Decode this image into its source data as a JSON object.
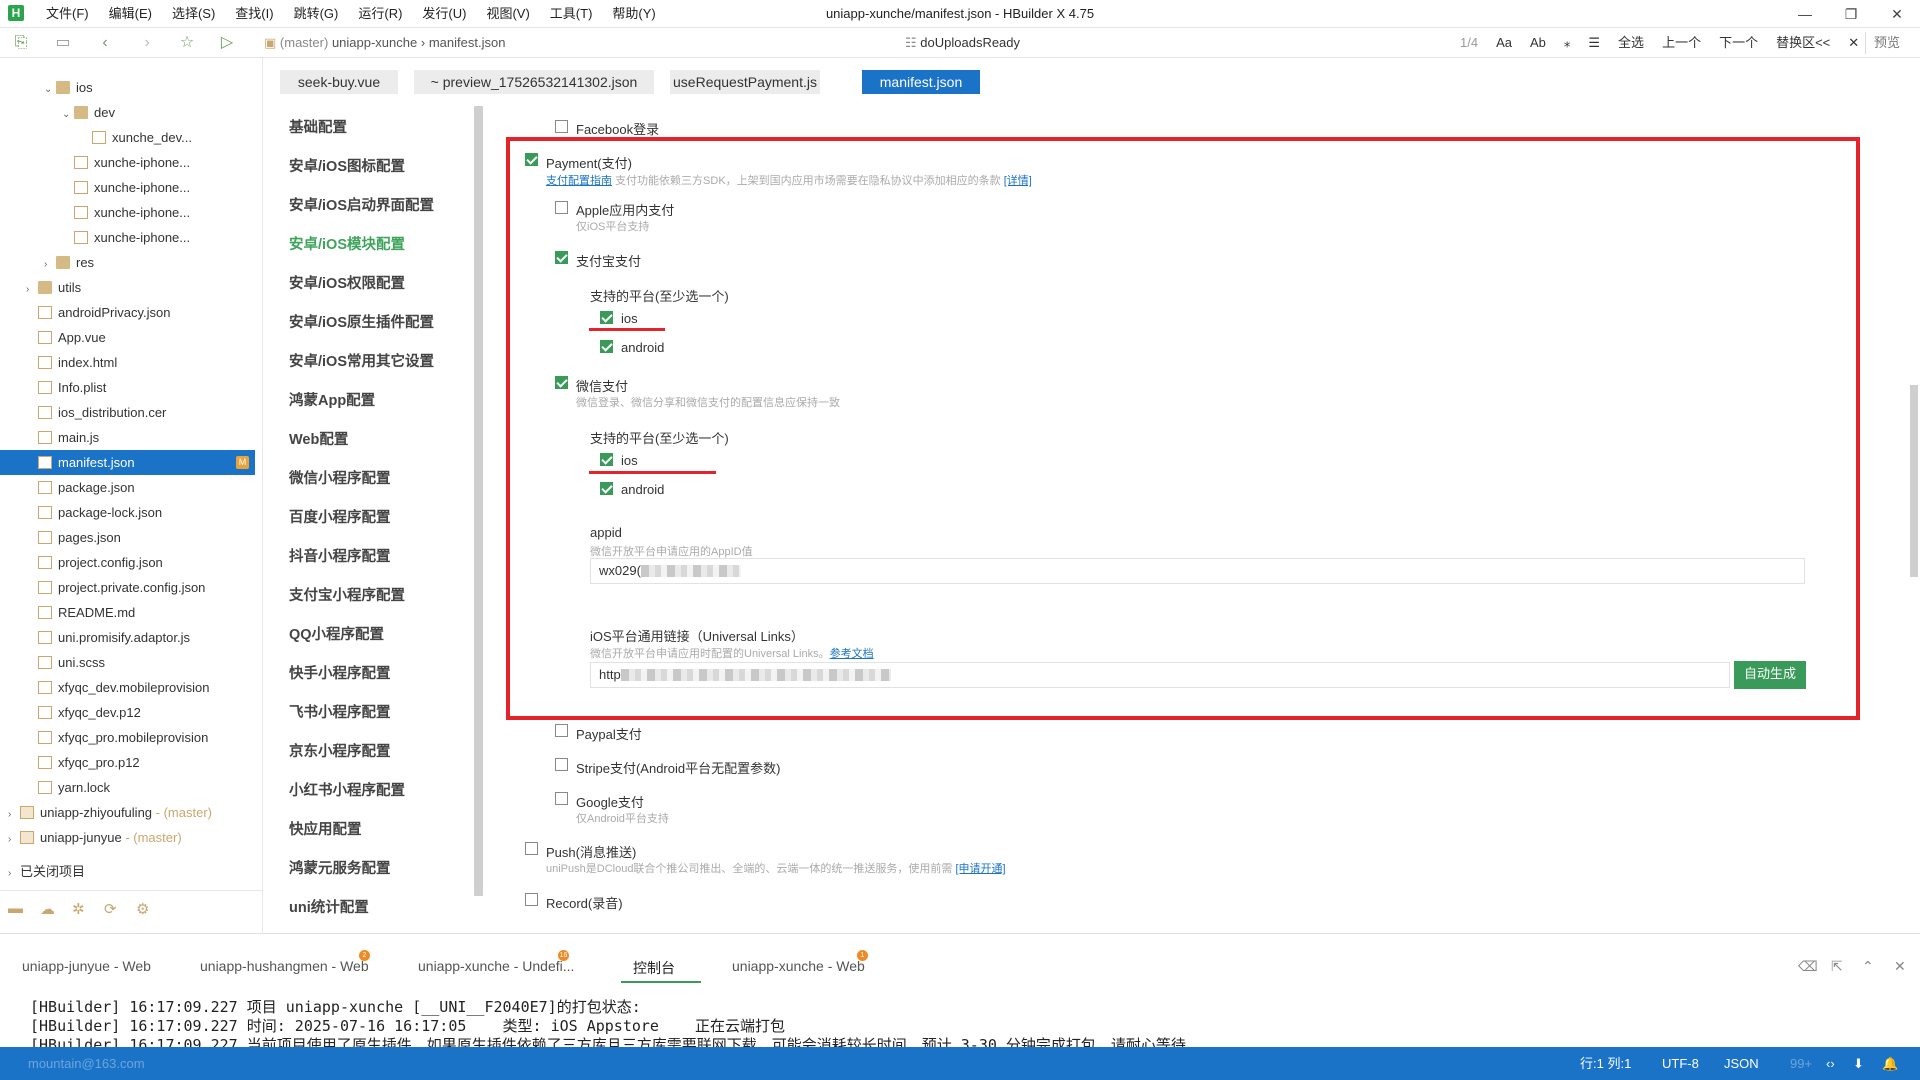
{
  "app": {
    "window_title": "uniapp-xunche/manifest.json - HBuilder X 4.75",
    "menu": [
      "文件(F)",
      "编辑(E)",
      "选择(S)",
      "查找(I)",
      "跳转(G)",
      "运行(R)",
      "发行(U)",
      "视图(V)",
      "工具(T)",
      "帮助(Y)"
    ],
    "window_controls": [
      "—",
      "❐",
      "✕"
    ]
  },
  "toolbar": {
    "breadcrumb_branch": "(master)",
    "breadcrumb_project": "uniapp-xunche",
    "breadcrumb_sep": "›",
    "breadcrumb_file": "manifest.json",
    "function_name": "doUploadsReady",
    "search_count": "1/4",
    "search_opts": [
      "Aa",
      "Ab",
      "⁎"
    ],
    "select_all": "全选",
    "prev": "上一个",
    "next": "下一个",
    "replace": "替换区<<",
    "close": "✕",
    "preview": "预览"
  },
  "tree": {
    "items": [
      {
        "label": "ios",
        "type": "folder",
        "indent": 3,
        "arrow": "⌄"
      },
      {
        "label": "dev",
        "type": "folder",
        "indent": 4,
        "arrow": "⌄"
      },
      {
        "label": "xunche_dev...",
        "type": "file",
        "indent": 5
      },
      {
        "label": "xunche-iphone...",
        "type": "file",
        "indent": 4
      },
      {
        "label": "xunche-iphone...",
        "type": "file",
        "indent": 4
      },
      {
        "label": "xunche-iphone...",
        "type": "file",
        "indent": 4
      },
      {
        "label": "xunche-iphone...",
        "type": "file",
        "indent": 4
      },
      {
        "label": "res",
        "type": "folder",
        "indent": 3,
        "arrow": "›"
      },
      {
        "label": "utils",
        "type": "folder",
        "indent": 2,
        "arrow": "›"
      },
      {
        "label": "androidPrivacy.json",
        "type": "file",
        "indent": 2
      },
      {
        "label": "App.vue",
        "type": "file",
        "indent": 2
      },
      {
        "label": "index.html",
        "type": "file",
        "indent": 2
      },
      {
        "label": "Info.plist",
        "type": "file",
        "indent": 2
      },
      {
        "label": "ios_distribution.cer",
        "type": "file",
        "indent": 2
      },
      {
        "label": "main.js",
        "type": "file",
        "indent": 2
      },
      {
        "label": "manifest.json",
        "type": "file",
        "indent": 2,
        "selected": true,
        "badge": "M"
      },
      {
        "label": "package.json",
        "type": "file",
        "indent": 2
      },
      {
        "label": "package-lock.json",
        "type": "file",
        "indent": 2
      },
      {
        "label": "pages.json",
        "type": "file",
        "indent": 2
      },
      {
        "label": "project.config.json",
        "type": "file",
        "indent": 2
      },
      {
        "label": "project.private.config.json",
        "type": "file",
        "indent": 2
      },
      {
        "label": "README.md",
        "type": "file",
        "indent": 2
      },
      {
        "label": "uni.promisify.adaptor.js",
        "type": "file",
        "indent": 2
      },
      {
        "label": "uni.scss",
        "type": "file",
        "indent": 2
      },
      {
        "label": "xfyqc_dev.mobileprovision",
        "type": "file",
        "indent": 2
      },
      {
        "label": "xfyqc_dev.p12",
        "type": "file",
        "indent": 2
      },
      {
        "label": "xfyqc_pro.mobileprovision",
        "type": "file",
        "indent": 2
      },
      {
        "label": "xfyqc_pro.p12",
        "type": "file",
        "indent": 2
      },
      {
        "label": "yarn.lock",
        "type": "file",
        "indent": 2
      }
    ],
    "projects": [
      {
        "name": "uniapp-zhiyoufuling",
        "branch": "- (master)"
      },
      {
        "name": "uniapp-junyue",
        "branch": "- (master)"
      }
    ],
    "closed_projects": "已关闭项目"
  },
  "tabs": [
    "seek-buy.vue",
    "~ preview_17526532141302.json",
    "useRequestPayment.js",
    "manifest.json"
  ],
  "nav": [
    "基础配置",
    "安卓/iOS图标配置",
    "安卓/iOS启动界面配置",
    "安卓/iOS模块配置",
    "安卓/iOS权限配置",
    "安卓/iOS原生插件配置",
    "安卓/iOS常用其它设置",
    "鸿蒙App配置",
    "Web配置",
    "微信小程序配置",
    "百度小程序配置",
    "抖音小程序配置",
    "支付宝小程序配置",
    "QQ小程序配置",
    "快手小程序配置",
    "飞书小程序配置",
    "京东小程序配置",
    "小红书小程序配置",
    "快应用配置",
    "鸿蒙元服务配置",
    "uni统计配置"
  ],
  "nav_active_index": 3,
  "content": {
    "facebook": "Facebook登录",
    "payment": "Payment(支付)",
    "payment_link": "支付配置指南",
    "payment_hint": "支付功能依赖三方SDK，上架到国内应用市场需要在隐私协议中添加相应的条款",
    "payment_detail": "[详情]",
    "apple": "Apple应用内支付",
    "apple_hint": "仅iOS平台支持",
    "alipay": "支付宝支付",
    "platform_label": "支持的平台(至少选一个)",
    "ios": "ios",
    "android": "android",
    "wechat": "微信支付",
    "wechat_hint": "微信登录、微信分享和微信支付的配置信息应保持一致",
    "appid_label": "appid",
    "appid_hint": "微信开放平台申请应用的AppID值",
    "appid_value": "wx029(",
    "ul_label": "iOS平台通用链接（Universal Links）",
    "ul_hint": "微信开放平台申请应用时配置的Universal Links。",
    "ul_hint_link": "参考文档",
    "ul_value": "http",
    "auto_gen": "自动生成",
    "paypal": "Paypal支付",
    "stripe": "Stripe支付(Android平台无配置参数)",
    "google": "Google支付",
    "google_hint": "仅Android平台支持",
    "push": "Push(消息推送)",
    "push_hint": "uniPush是DCloud联合个推公司推出、全端的、云端一体的统一推送服务，使用前需",
    "push_link": "[申请开通]",
    "record": "Record(录音)"
  },
  "console": {
    "tabs": [
      {
        "label": "uniapp-junyue - Web"
      },
      {
        "label": "uniapp-hushangmen - Web",
        "dot": "2"
      },
      {
        "label": "uniapp-xunche - Undefi...",
        "dot": "16"
      },
      {
        "label": "控制台",
        "active": true
      },
      {
        "label": "uniapp-xunche - Web",
        "dot": "1"
      }
    ],
    "lines": [
      "[HBuilder] 16:17:09.227 项目 uniapp-xunche [__UNI__F2040E7]的打包状态:",
      "[HBuilder] 16:17:09.227 时间: 2025-07-16 16:17:05    类型: iOS Appstore    正在云端打包",
      "[HBuilder] 16:17:09.227 当前项目使用了原生插件，如果原生插件依赖了三方库且三方库需要联网下载，可能会消耗较长时间，预计 3-30 分钟完成打包，请耐心等待"
    ]
  },
  "status": {
    "account": "mountain@163.com",
    "pos": "行:1  列:1",
    "encoding": "UTF-8",
    "lang": "JSON",
    "extra": "99+"
  }
}
